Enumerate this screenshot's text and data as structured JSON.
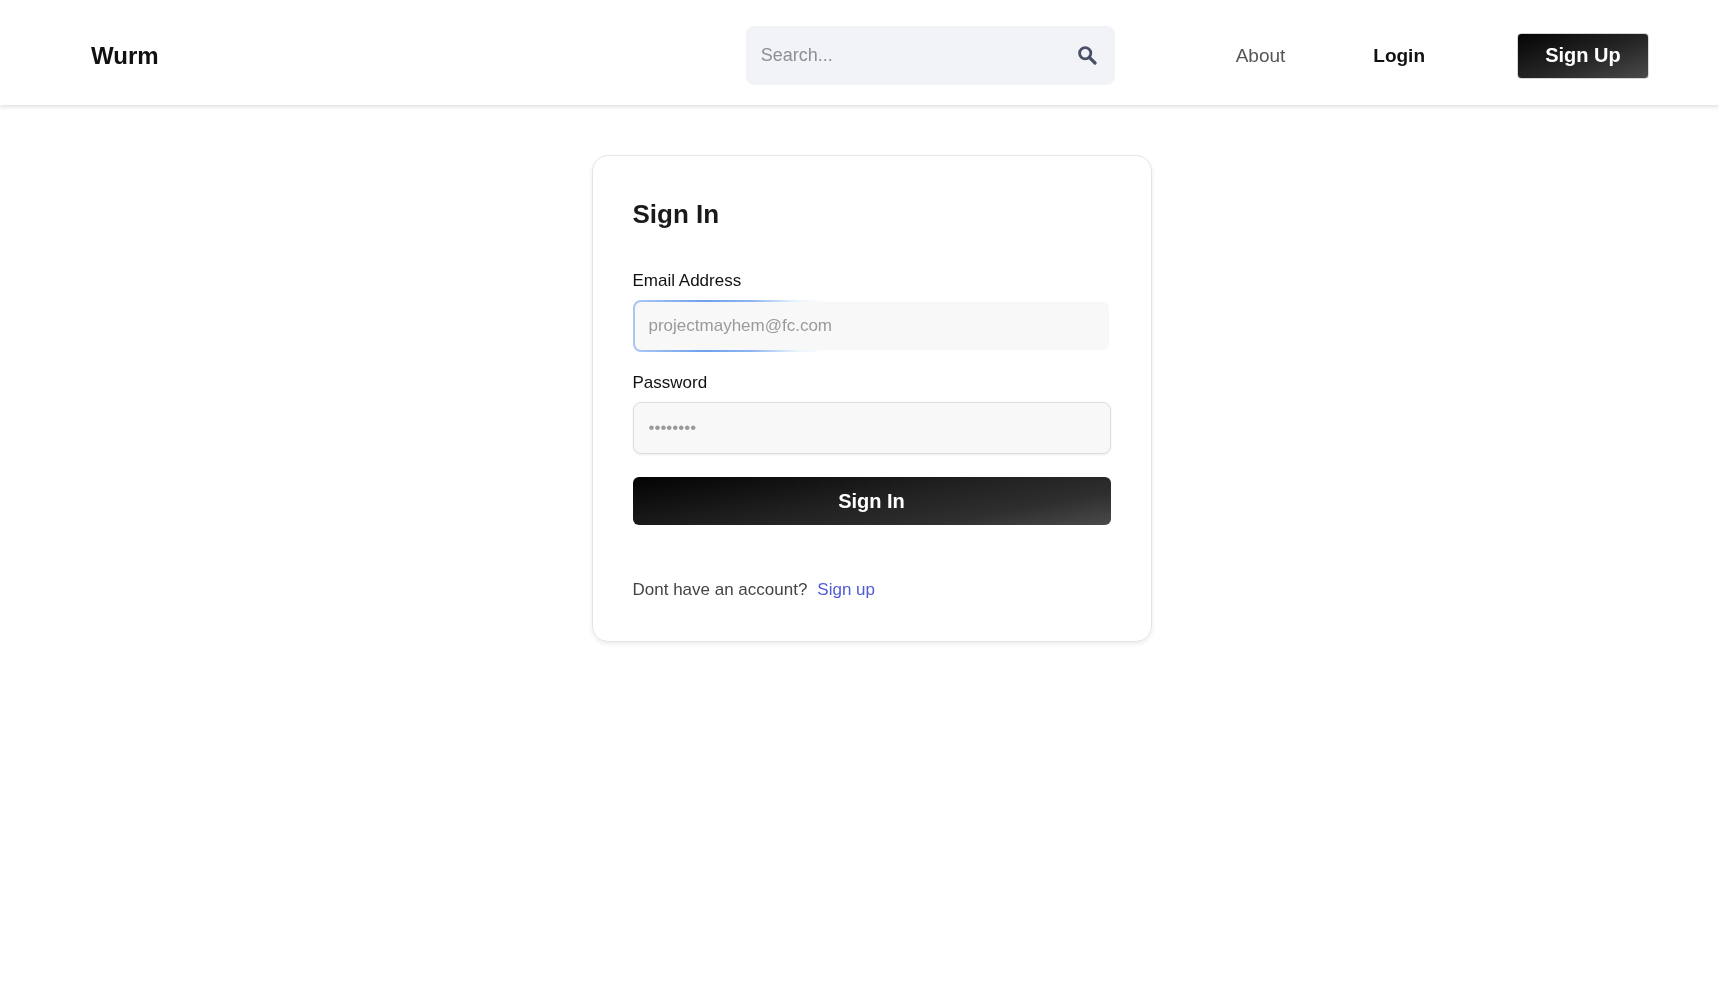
{
  "header": {
    "logo": "Wurm",
    "search": {
      "placeholder": "Search..."
    },
    "nav_links": [
      {
        "label": "About",
        "selected": false
      },
      {
        "label": "Login",
        "selected": true
      }
    ],
    "signup_button": "Sign Up"
  },
  "form": {
    "title": "Sign In",
    "fields": [
      {
        "label": "Email Address",
        "placeholder": "projectmayhem@fc.com",
        "focused": true
      },
      {
        "label": "Password",
        "placeholder": "••••••••",
        "focused": false
      }
    ],
    "submit": "Sign In",
    "footer": {
      "text": "Dont have an account?",
      "link": "Sign up"
    }
  }
}
